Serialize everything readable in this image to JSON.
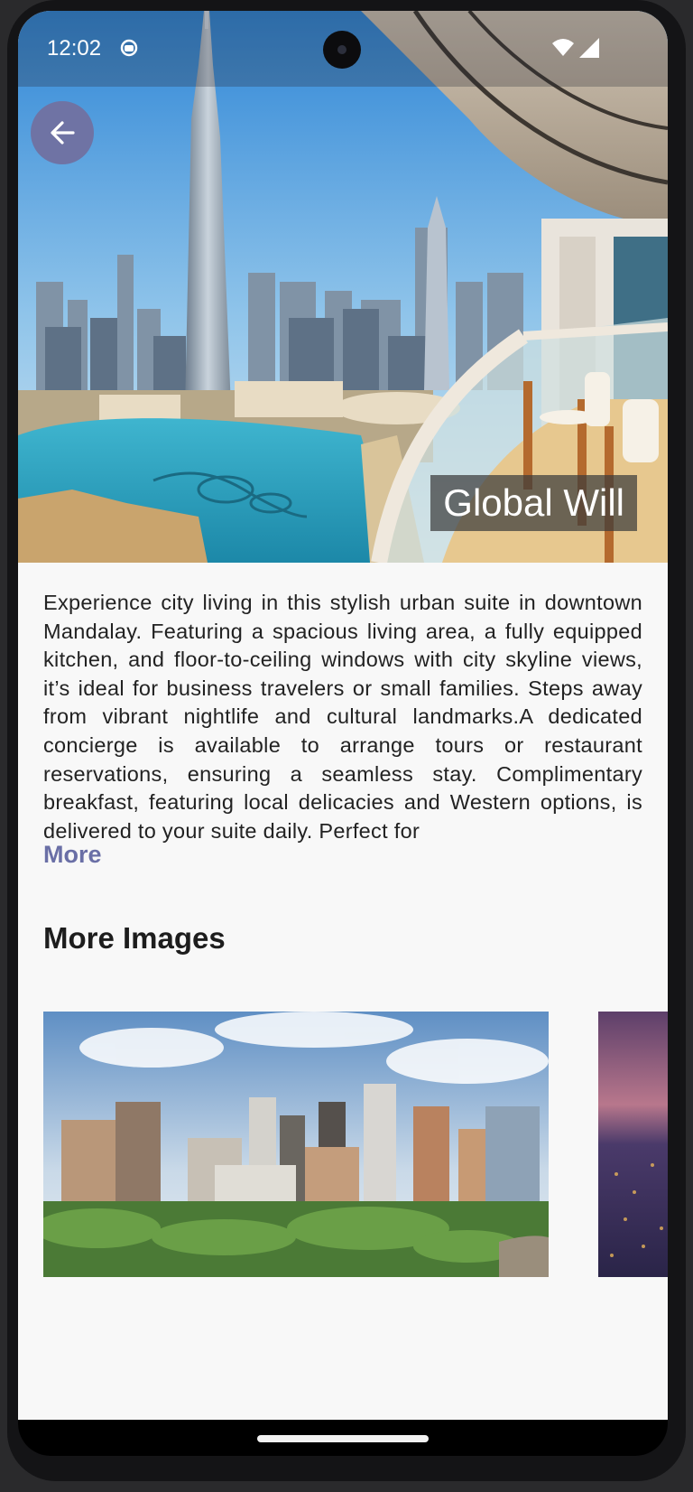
{
  "status_bar": {
    "time": "12:02",
    "icons": [
      "sync-icon",
      "wifi-icon",
      "signal-icon"
    ]
  },
  "header": {
    "back_icon": "arrow-left-icon",
    "title": "Global Will",
    "accent_color": "#6f73a4"
  },
  "description": {
    "text": "Experience city living in this stylish urban suite in downtown Mandalay. Featuring a spacious living area, a fully equipped kitchen, and floor-to-ceiling windows with city skyline views, it’s ideal for business travelers or small families. Steps away from vibrant nightlife and cultural landmarks.A dedicated concierge is available to arrange tours or restaurant reservations, ensuring a seamless stay. Complimentary breakfast, featuring local delicacies and Western options, is delivered to your suite daily. Perfect for",
    "more_label": "More"
  },
  "gallery": {
    "title": "More Images"
  }
}
